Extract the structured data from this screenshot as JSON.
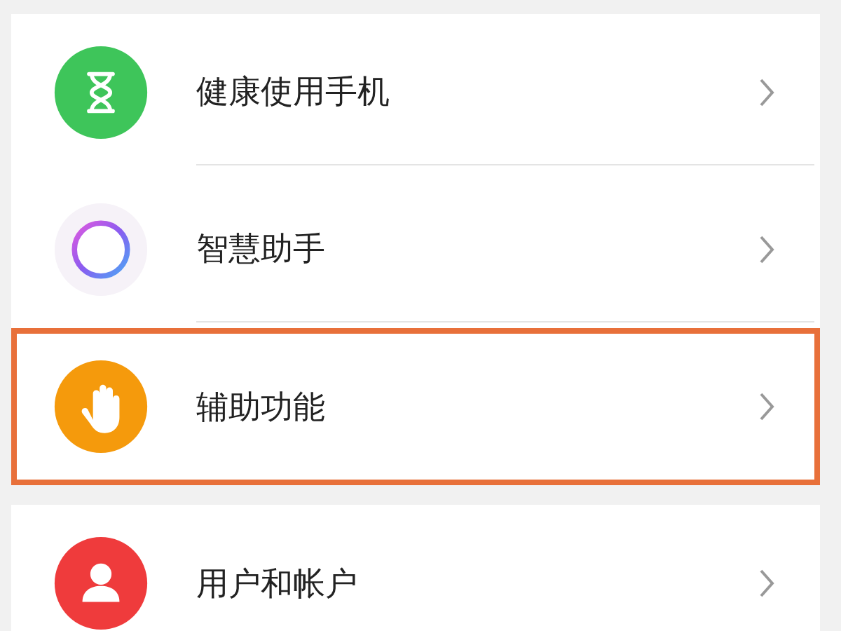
{
  "sections": [
    {
      "items": [
        {
          "kind": "hourglass",
          "label": "健康使用手机",
          "highlighted": false
        },
        {
          "kind": "ring",
          "label": "智慧助手",
          "highlighted": false
        },
        {
          "kind": "hand",
          "label": "辅助功能",
          "highlighted": true
        }
      ]
    },
    {
      "items": [
        {
          "kind": "person",
          "label": "用户和帐户",
          "highlighted": false
        }
      ]
    }
  ]
}
